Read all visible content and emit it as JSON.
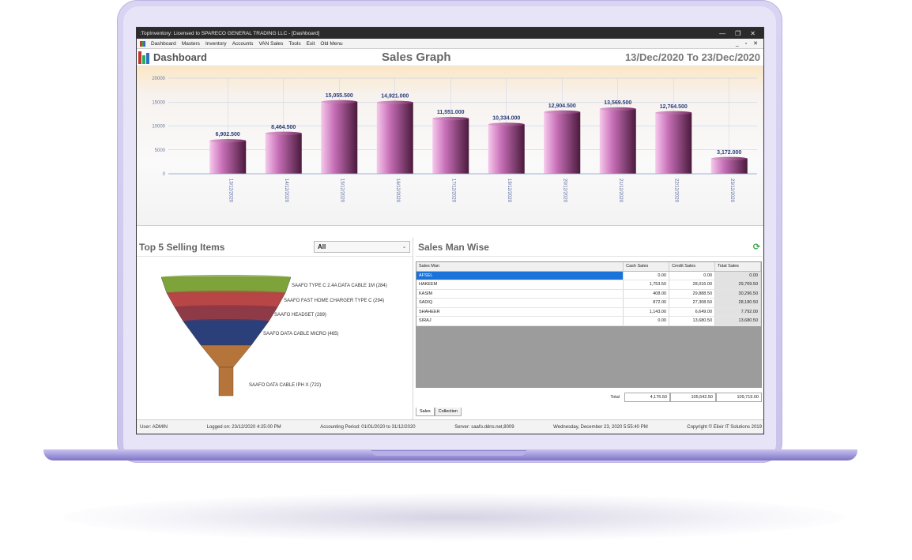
{
  "window": {
    "title": ":TopInventory: Licensed to SPARECO GENERAL TRADING LLC - [Dashboard]",
    "controls": [
      "—",
      "❐",
      "✕"
    ]
  },
  "menu": {
    "items": [
      "Dashboard",
      "Masters",
      "Inventory",
      "Accounts",
      "VAN Sales",
      "Tools",
      "Exit",
      "Old Menu"
    ],
    "mdi_controls": "_ ▫ ✕"
  },
  "dashboard": {
    "title": "Dashboard",
    "graph_title": "Sales Graph",
    "date_range": "13/Dec/2020 To 23/Dec/2020"
  },
  "chart_data": {
    "type": "bar",
    "categories": [
      "13/12/2020",
      "14/12/2020",
      "15/12/2020",
      "16/12/2020",
      "17/12/2020",
      "19/12/2020",
      "20/12/2020",
      "21/12/2020",
      "22/12/2020",
      "23/12/2020"
    ],
    "values": [
      6902.5,
      8464.5,
      15055.5,
      14921.0,
      11551.0,
      10334.0,
      12904.5,
      13569.5,
      12764.5,
      3172.0
    ],
    "labels": [
      "6,902.500",
      "8,464.500",
      "15,055.500",
      "14,921.000",
      "11,551.000",
      "10,334.000",
      "12,904.500",
      "13,569.500",
      "12,764.500",
      "3,172.000"
    ],
    "yticks": [
      "0",
      "5000",
      "10000",
      "15000",
      "20000"
    ],
    "ylim": [
      0,
      20000
    ],
    "grid": true,
    "bar_color": "#c870b8"
  },
  "top_selling": {
    "title": "Top 5 Selling Items",
    "filter_value": "All",
    "items": [
      {
        "label": "SAAFO TYPE C 2.4A DATA CABLE 1M (284)",
        "color": "#7ea33b"
      },
      {
        "label": "SAAFO FAST HOME CHARGER TYPE C (294)",
        "color": "#b84646"
      },
      {
        "label": "SAAFO HEADSET (289)",
        "color": "#8f3a47"
      },
      {
        "label": "SAAFO DATA CABLE MICRO (465)",
        "color": "#2b3f7a"
      },
      {
        "label": "SAAFO DATA CABLE IPH X (722)",
        "color": "#b5743a"
      }
    ]
  },
  "salesman": {
    "title": "Sales Man Wise",
    "columns": [
      "Sales Man",
      "Cash Sales",
      "Credit Sales",
      "Total Sales"
    ],
    "rows": [
      [
        "AFSEL",
        "0.00",
        "0.00",
        "0.00"
      ],
      [
        "HAKEEM",
        "1,753.50",
        "28,016.00",
        "29,769.50"
      ],
      [
        "KASIM",
        "408.00",
        "29,888.50",
        "30,296.50"
      ],
      [
        "SADIQ",
        "872.00",
        "27,308.50",
        "28,180.50"
      ],
      [
        "SHAHEER",
        "1,143.00",
        "6,649.00",
        "7,792.00"
      ],
      [
        "SIRAJ",
        "0.00",
        "13,680.50",
        "13,680.50"
      ]
    ],
    "total_label": "Total",
    "totals": [
      "4,176.50",
      "105,542.50",
      "109,719.00"
    ],
    "tabs": [
      "Sales",
      "Collection"
    ]
  },
  "status": {
    "user": "User: ADMIN",
    "logged_on": "Logged on: 23/12/2020 4:25:00 PM",
    "period": "Accounting Period: 01/01/2020 to 31/12/2020",
    "server": "Server: saafo.ddns.net,8009",
    "datetime": "Wednesday, December 23, 2020  5:55:40 PM",
    "copyright": "Copyright © Elixir IT Solutions 2019"
  }
}
